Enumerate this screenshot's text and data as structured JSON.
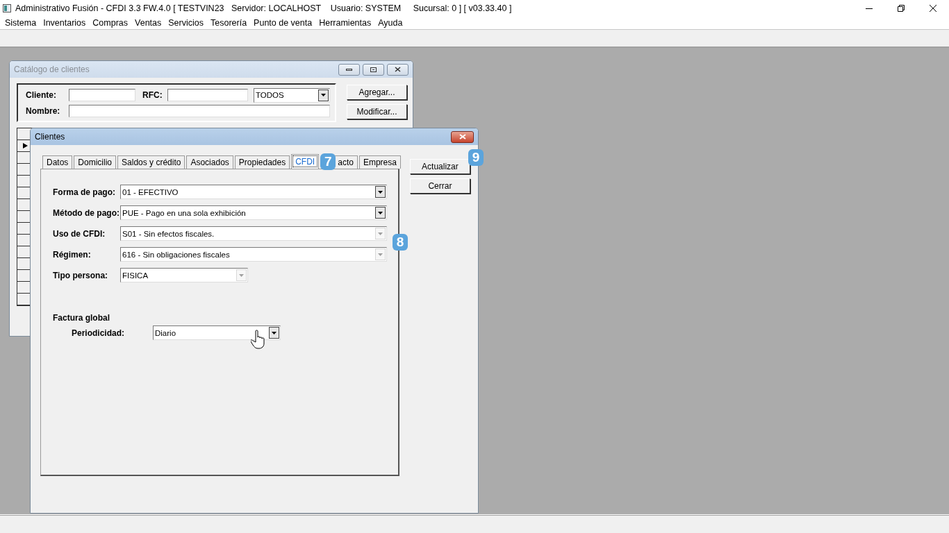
{
  "window": {
    "title": "Administrativo Fusión - CFDI 3.3 FW.4.0 [ TESTVIN23   Servidor: LOCALHOST    Usuario: SYSTEM     Sucursal: 0 ] [ v03.33.40 ]"
  },
  "menu": [
    "Sistema",
    "Inventarios",
    "Compras",
    "Ventas",
    "Servicios",
    "Tesorería",
    "Punto de venta",
    "Herramientas",
    "Ayuda"
  ],
  "catalog": {
    "title": "Catálogo de clientes",
    "cliente_label": "Cliente:",
    "rfc_label": "RFC:",
    "filter_value": "TODOS",
    "nombre_label": "Nombre:",
    "buttons": [
      "Agregar...",
      "Modificar..."
    ],
    "rows": [
      {
        "selected": false
      },
      {
        "selected": true
      },
      {
        "selected": false
      },
      {
        "selected": false
      },
      {
        "selected": false
      },
      {
        "selected": false
      },
      {
        "selected": false
      },
      {
        "selected": false
      },
      {
        "selected": false
      },
      {
        "selected": false
      },
      {
        "selected": false
      },
      {
        "selected": false
      },
      {
        "selected": false
      },
      {
        "selected": false
      },
      {
        "selected": false
      }
    ]
  },
  "dialog": {
    "title": "Clientes",
    "tabs": [
      {
        "label": "Datos",
        "selected": false
      },
      {
        "label": "Domicilio",
        "selected": false
      },
      {
        "label": "Saldos y crédito",
        "selected": false
      },
      {
        "label": "Asociados",
        "selected": false
      },
      {
        "label": "Propiedades",
        "selected": false
      },
      {
        "label": "CFDI",
        "selected": true
      },
      {
        "label": "acto",
        "selected": false
      },
      {
        "label": "Empresa",
        "selected": false
      }
    ],
    "fields": [
      {
        "label": "Forma de pago:",
        "value": "01 - EFECTIVO",
        "disabled": false
      },
      {
        "label": "Método de pago:",
        "value": "PUE - Pago en una sola exhibición",
        "disabled": false
      },
      {
        "label": "Uso de CFDI:",
        "value": "S01 - Sin efectos fiscales.",
        "disabled": true
      },
      {
        "label": "Régimen:",
        "value": "616 - Sin obligaciones fiscales",
        "disabled": true
      },
      {
        "label": "Tipo persona:",
        "value": "FISICA",
        "disabled": true
      }
    ],
    "section_title": "Factura global",
    "periodicidad": {
      "label": "Periodicidad:",
      "value": "Diario",
      "disabled": false
    },
    "buttons": [
      "Actualizar",
      "Cerrar"
    ]
  },
  "annotations": [
    "7",
    "8",
    "9"
  ]
}
